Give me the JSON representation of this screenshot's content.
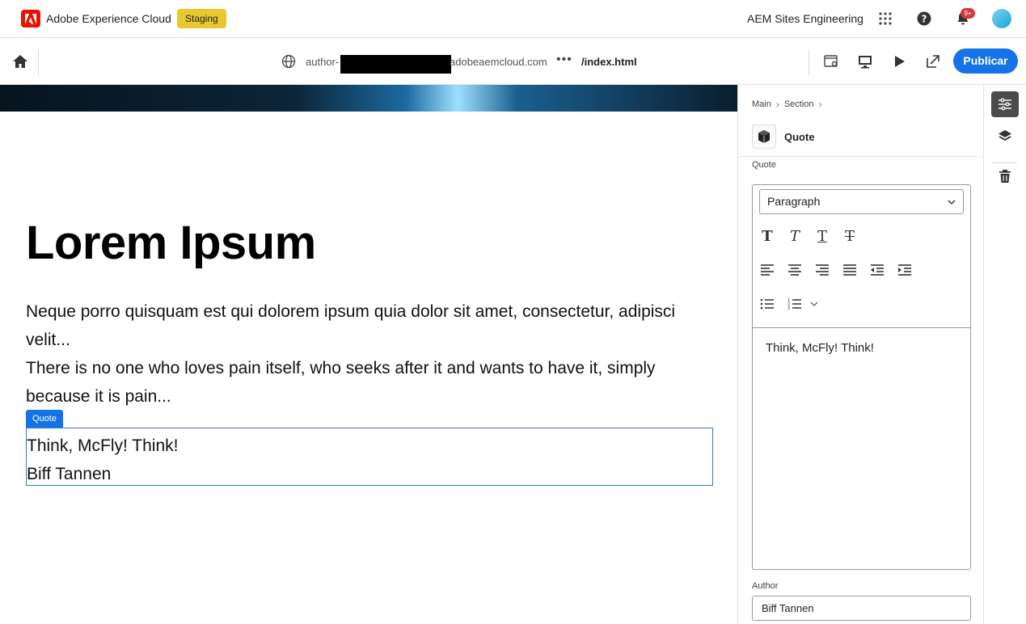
{
  "topbar": {
    "brand": "Adobe Experience Cloud",
    "env_badge": "Staging",
    "org": "AEM Sites Engineering",
    "notifications_badge": "9+",
    "icons": [
      "apps-grid-icon",
      "help-icon",
      "bell-icon",
      "avatar"
    ]
  },
  "editbar": {
    "url_prefix": "author-",
    "url_domain": "adobeaemcloud.com",
    "more": "•••",
    "page_path": "/index.html",
    "publish_label": "Publicar",
    "tools": [
      "page-properties-icon",
      "desktop-preview-icon",
      "play-icon",
      "open-external-icon"
    ]
  },
  "canvas": {
    "title": "Lorem Ipsum",
    "body_line1": "Neque porro quisquam est qui dolorem ipsum quia dolor sit amet, consectetur, adipisci velit...",
    "body_line2": "There is no one who loves pain itself, who seeks after it and wants to have it, simply because it is pain...",
    "quote_tag": "Quote",
    "quote_text": "Think, McFly! Think!",
    "quote_author": "Biff Tannen"
  },
  "panel": {
    "breadcrumb": [
      "Main",
      "Section"
    ],
    "component_title": "Quote",
    "quote_label": "Quote",
    "format_select": "Paragraph",
    "rte_text": "Think, McFly! Think!",
    "author_label": "Author",
    "author_value": "Biff Tannen"
  },
  "colors": {
    "accent": "#1473e6",
    "staging": "#e8c72f",
    "adobe_red": "#eb1000"
  }
}
